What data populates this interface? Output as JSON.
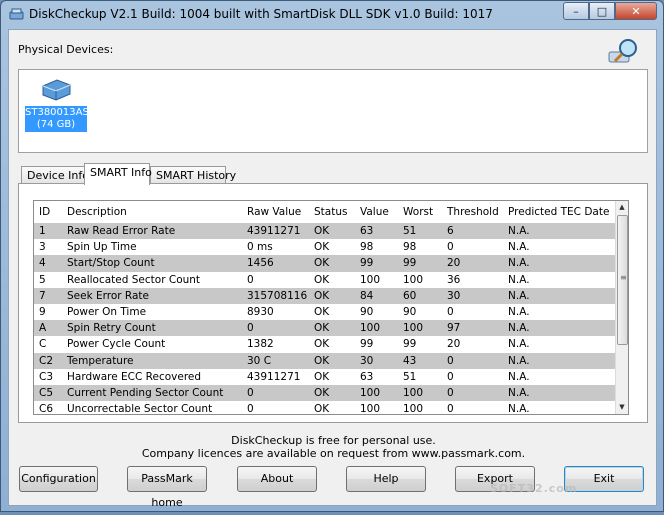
{
  "window": {
    "title": "DiskCheckup V2.1 Build: 1004 built with SmartDisk DLL SDK v1.0 Build: 1017",
    "min_label": "–",
    "max_label": "□",
    "close_label": "✕"
  },
  "devices": {
    "label": "Physical Devices:",
    "items": [
      {
        "name": "ST380013AS",
        "size": "(74 GB)"
      }
    ]
  },
  "tabs": [
    {
      "label": "Device Info",
      "active": false
    },
    {
      "label": "SMART Info",
      "active": true
    },
    {
      "label": "SMART History",
      "active": false
    }
  ],
  "table": {
    "headers": [
      "ID",
      "Description",
      "Raw Value",
      "Status",
      "Value",
      "Worst",
      "Threshold",
      "Predicted TEC Date"
    ],
    "rows": [
      [
        "1",
        "Raw Read Error Rate",
        "43911271",
        "OK",
        "63",
        "51",
        "6",
        "N.A."
      ],
      [
        "3",
        "Spin Up Time",
        "0 ms",
        "OK",
        "98",
        "98",
        "0",
        "N.A."
      ],
      [
        "4",
        "Start/Stop Count",
        "1456",
        "OK",
        "99",
        "99",
        "20",
        "N.A."
      ],
      [
        "5",
        "Reallocated Sector Count",
        "0",
        "OK",
        "100",
        "100",
        "36",
        "N.A."
      ],
      [
        "7",
        "Seek Error Rate",
        "315708116",
        "OK",
        "84",
        "60",
        "30",
        "N.A."
      ],
      [
        "9",
        "Power On Time",
        "8930",
        "OK",
        "90",
        "90",
        "0",
        "N.A."
      ],
      [
        "A",
        "Spin Retry Count",
        "0",
        "OK",
        "100",
        "100",
        "97",
        "N.A."
      ],
      [
        "C",
        "Power Cycle Count",
        "1382",
        "OK",
        "99",
        "99",
        "20",
        "N.A."
      ],
      [
        "C2",
        "Temperature",
        "30 C",
        "OK",
        "30",
        "43",
        "0",
        "N.A."
      ],
      [
        "C3",
        "Hardware ECC Recovered",
        "43911271",
        "OK",
        "63",
        "51",
        "0",
        "N.A."
      ],
      [
        "C5",
        "Current Pending Sector Count",
        "0",
        "OK",
        "100",
        "100",
        "0",
        "N.A."
      ],
      [
        "C6",
        "Uncorrectable Sector Count",
        "0",
        "OK",
        "100",
        "100",
        "0",
        "N.A."
      ]
    ]
  },
  "scrollbar": {
    "up": "▲",
    "down": "▼",
    "grip": "≡"
  },
  "footer": {
    "line1": "DiskCheckup is free for personal use.",
    "line2": "Company licences are available on request from www.passmark.com."
  },
  "buttons": {
    "configuration": "Configuration",
    "passmark_home": "PassMark home",
    "about": "About",
    "help": "Help",
    "export": "Export",
    "exit": "Exit"
  },
  "watermark": "SOFT32.com"
}
